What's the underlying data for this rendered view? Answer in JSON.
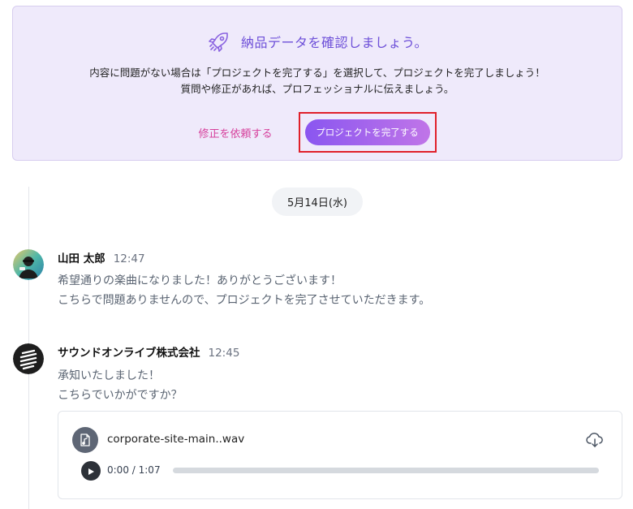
{
  "notice": {
    "title": "納品データを確認しましょう。",
    "line1": "内容に問題がない場合は「プロジェクトを完了する」を選択して、プロジェクトを完了しましょう！",
    "line2": "質問や修正があれば、プロフェッショナルに伝えましょう。",
    "revise_label": "修正を依頼する",
    "complete_label": "プロジェクトを完了する"
  },
  "timeline": {
    "date": "5月14日(水)"
  },
  "messages": [
    {
      "sender": "山田 太郎",
      "time": "12:47",
      "lines": [
        "希望通りの楽曲になりました！ありがとうございます！",
        "こちらで問題ありませんので、プロジェクトを完了させていただきます。"
      ]
    },
    {
      "sender": "サウンドオンライブ株式会社",
      "time": "12:45",
      "lines": [
        "承知いたしました！",
        "こちらでいかがですか？"
      ],
      "attachment": {
        "file_name": "corporate-site-main..wav",
        "current_time": "0:00",
        "separator": " / ",
        "duration": "1:07",
        "progress": 0
      }
    }
  ],
  "colors": {
    "accent": "#8a56f0",
    "link_pink": "#d6409c",
    "highlight_red": "#e0202a",
    "banner_bg": "#efeafb"
  },
  "icons": [
    "rocket-icon",
    "file-audio-icon",
    "download-icon",
    "play-icon"
  ]
}
